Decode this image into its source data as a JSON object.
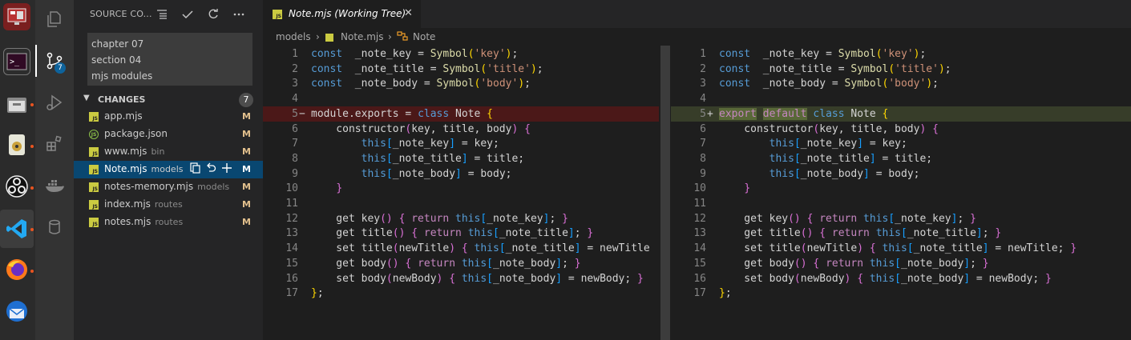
{
  "sidebar": {
    "title": "SOURCE CO...",
    "commit_message": [
      "chapter 07",
      "section 04",
      "mjs modules"
    ],
    "changes_label": "CHANGES",
    "changes_count": "7",
    "scm_badge": "7",
    "files": [
      {
        "name": "app.mjs",
        "dir": "",
        "status": "M",
        "icon": "js-file-icon"
      },
      {
        "name": "package.json",
        "dir": "",
        "status": "M",
        "icon": "json-file-icon"
      },
      {
        "name": "www.mjs",
        "dir": "bin",
        "status": "M",
        "icon": "js-file-icon"
      },
      {
        "name": "Note.mjs",
        "dir": "models",
        "status": "M",
        "icon": "js-file-icon",
        "selected": true
      },
      {
        "name": "notes-memory.mjs",
        "dir": "models",
        "status": "M",
        "icon": "js-file-icon"
      },
      {
        "name": "index.mjs",
        "dir": "routes",
        "status": "M",
        "icon": "js-file-icon"
      },
      {
        "name": "notes.mjs",
        "dir": "routes",
        "status": "M",
        "icon": "js-file-icon"
      }
    ]
  },
  "tab": {
    "label": "Note.mjs (Working Tree)",
    "close": "✕"
  },
  "breadcrumb": {
    "items": [
      "models",
      "Note.mjs",
      "Note"
    ]
  },
  "diff": {
    "left": [
      {
        "n": "1",
        "marker": "",
        "tokens": [
          [
            "kw",
            "const"
          ],
          [
            "",
            "  _note_key "
          ],
          [
            "",
            "= "
          ],
          [
            "fn",
            "Symbol"
          ],
          [
            "br1",
            "("
          ],
          [
            "str",
            "'key'"
          ],
          [
            "br1",
            ")"
          ],
          [
            "",
            ";"
          ]
        ]
      },
      {
        "n": "2",
        "marker": "",
        "tokens": [
          [
            "kw",
            "const"
          ],
          [
            "",
            "  _note_title "
          ],
          [
            "",
            "= "
          ],
          [
            "fn",
            "Symbol"
          ],
          [
            "br1",
            "("
          ],
          [
            "str",
            "'title'"
          ],
          [
            "br1",
            ")"
          ],
          [
            "",
            ";"
          ]
        ]
      },
      {
        "n": "3",
        "marker": "",
        "tokens": [
          [
            "kw",
            "const"
          ],
          [
            "",
            "  _note_body "
          ],
          [
            "",
            "= "
          ],
          [
            "fn",
            "Symbol"
          ],
          [
            "br1",
            "("
          ],
          [
            "str",
            "'body'"
          ],
          [
            "br1",
            ")"
          ],
          [
            "",
            ";"
          ]
        ]
      },
      {
        "n": "4",
        "marker": "",
        "tokens": []
      },
      {
        "n": "5",
        "marker": "−",
        "type": "removed",
        "tokens": [
          [
            "",
            "module.exports = "
          ],
          [
            "kw",
            "class"
          ],
          [
            "",
            " Note "
          ],
          [
            "br1",
            "{"
          ]
        ]
      },
      {
        "n": "6",
        "marker": "",
        "tokens": [
          [
            "",
            "    constructor"
          ],
          [
            "br2",
            "("
          ],
          [
            "",
            "key, title, body"
          ],
          [
            "br2",
            ")"
          ],
          [
            "",
            " "
          ],
          [
            "br2",
            "{"
          ]
        ]
      },
      {
        "n": "7",
        "marker": "",
        "tokens": [
          [
            "",
            "        "
          ],
          [
            "kw",
            "this"
          ],
          [
            "br3",
            "["
          ],
          [
            "",
            "_note_key"
          ],
          [
            "br3",
            "]"
          ],
          [
            "",
            " = key;"
          ]
        ]
      },
      {
        "n": "8",
        "marker": "",
        "tokens": [
          [
            "",
            "        "
          ],
          [
            "kw",
            "this"
          ],
          [
            "br3",
            "["
          ],
          [
            "",
            "_note_title"
          ],
          [
            "br3",
            "]"
          ],
          [
            "",
            " = title;"
          ]
        ]
      },
      {
        "n": "9",
        "marker": "",
        "tokens": [
          [
            "",
            "        "
          ],
          [
            "kw",
            "this"
          ],
          [
            "br3",
            "["
          ],
          [
            "",
            "_note_body"
          ],
          [
            "br3",
            "]"
          ],
          [
            "",
            " = body;"
          ]
        ]
      },
      {
        "n": "10",
        "marker": "",
        "tokens": [
          [
            "",
            "    "
          ],
          [
            "br2",
            "}"
          ]
        ]
      },
      {
        "n": "11",
        "marker": "",
        "tokens": []
      },
      {
        "n": "12",
        "marker": "",
        "tokens": [
          [
            "",
            "    get key"
          ],
          [
            "br2",
            "()"
          ],
          [
            "",
            " "
          ],
          [
            "br2",
            "{"
          ],
          [
            "",
            " "
          ],
          [
            "ctl",
            "return"
          ],
          [
            "",
            " "
          ],
          [
            "kw",
            "this"
          ],
          [
            "br3",
            "["
          ],
          [
            "",
            "_note_key"
          ],
          [
            "br3",
            "]"
          ],
          [
            "",
            "; "
          ],
          [
            "br2",
            "}"
          ]
        ]
      },
      {
        "n": "13",
        "marker": "",
        "tokens": [
          [
            "",
            "    get title"
          ],
          [
            "br2",
            "()"
          ],
          [
            "",
            " "
          ],
          [
            "br2",
            "{"
          ],
          [
            "",
            " "
          ],
          [
            "ctl",
            "return"
          ],
          [
            "",
            " "
          ],
          [
            "kw",
            "this"
          ],
          [
            "br3",
            "["
          ],
          [
            "",
            "_note_title"
          ],
          [
            "br3",
            "]"
          ],
          [
            "",
            "; "
          ],
          [
            "br2",
            "}"
          ]
        ]
      },
      {
        "n": "14",
        "marker": "",
        "tokens": [
          [
            "",
            "    set title"
          ],
          [
            "br2",
            "("
          ],
          [
            "",
            "newTitle"
          ],
          [
            "br2",
            ")"
          ],
          [
            "",
            " "
          ],
          [
            "br2",
            "{"
          ],
          [
            "",
            " "
          ],
          [
            "kw",
            "this"
          ],
          [
            "br3",
            "["
          ],
          [
            "",
            "_note_title"
          ],
          [
            "br3",
            "]"
          ],
          [
            "",
            " = newTitle"
          ]
        ]
      },
      {
        "n": "15",
        "marker": "",
        "tokens": [
          [
            "",
            "    get body"
          ],
          [
            "br2",
            "()"
          ],
          [
            "",
            " "
          ],
          [
            "br2",
            "{"
          ],
          [
            "",
            " "
          ],
          [
            "ctl",
            "return"
          ],
          [
            "",
            " "
          ],
          [
            "kw",
            "this"
          ],
          [
            "br3",
            "["
          ],
          [
            "",
            "_note_body"
          ],
          [
            "br3",
            "]"
          ],
          [
            "",
            "; "
          ],
          [
            "br2",
            "}"
          ]
        ]
      },
      {
        "n": "16",
        "marker": "",
        "tokens": [
          [
            "",
            "    set body"
          ],
          [
            "br2",
            "("
          ],
          [
            "",
            "newBody"
          ],
          [
            "br2",
            ")"
          ],
          [
            "",
            " "
          ],
          [
            "br2",
            "{"
          ],
          [
            "",
            " "
          ],
          [
            "kw",
            "this"
          ],
          [
            "br3",
            "["
          ],
          [
            "",
            "_note_body"
          ],
          [
            "br3",
            "]"
          ],
          [
            "",
            " = newBody; "
          ],
          [
            "br2",
            "}"
          ]
        ]
      },
      {
        "n": "17",
        "marker": "",
        "tokens": [
          [
            "br1",
            "}"
          ],
          [
            "",
            ";"
          ]
        ]
      }
    ],
    "right": [
      {
        "n": "1",
        "marker": "",
        "tokens": [
          [
            "kw",
            "const"
          ],
          [
            "",
            "  _note_key "
          ],
          [
            "",
            "= "
          ],
          [
            "fn",
            "Symbol"
          ],
          [
            "br1",
            "("
          ],
          [
            "str",
            "'key'"
          ],
          [
            "br1",
            ")"
          ],
          [
            "",
            ";"
          ]
        ]
      },
      {
        "n": "2",
        "marker": "",
        "tokens": [
          [
            "kw",
            "const"
          ],
          [
            "",
            "  _note_title "
          ],
          [
            "",
            "= "
          ],
          [
            "fn",
            "Symbol"
          ],
          [
            "br1",
            "("
          ],
          [
            "str",
            "'title'"
          ],
          [
            "br1",
            ")"
          ],
          [
            "",
            ";"
          ]
        ]
      },
      {
        "n": "3",
        "marker": "",
        "tokens": [
          [
            "kw",
            "const"
          ],
          [
            "",
            "  _note_body "
          ],
          [
            "",
            "= "
          ],
          [
            "fn",
            "Symbol"
          ],
          [
            "br1",
            "("
          ],
          [
            "str",
            "'body'"
          ],
          [
            "br1",
            ")"
          ],
          [
            "",
            ";"
          ]
        ]
      },
      {
        "n": "4",
        "marker": "",
        "tokens": []
      },
      {
        "n": "5",
        "marker": "+",
        "type": "added",
        "tokens": [
          [
            "ctl hl-add",
            "export"
          ],
          [
            "",
            " "
          ],
          [
            "ctl hl-add",
            "default"
          ],
          [
            "",
            " "
          ],
          [
            "kw",
            "class"
          ],
          [
            "",
            " Note "
          ],
          [
            "br1",
            "{"
          ]
        ]
      },
      {
        "n": "6",
        "marker": "",
        "tokens": [
          [
            "",
            "    constructor"
          ],
          [
            "br2",
            "("
          ],
          [
            "",
            "key, title, body"
          ],
          [
            "br2",
            ")"
          ],
          [
            "",
            " "
          ],
          [
            "br2",
            "{"
          ]
        ]
      },
      {
        "n": "7",
        "marker": "",
        "tokens": [
          [
            "",
            "        "
          ],
          [
            "kw",
            "this"
          ],
          [
            "br3",
            "["
          ],
          [
            "",
            "_note_key"
          ],
          [
            "br3",
            "]"
          ],
          [
            "",
            " = key;"
          ]
        ]
      },
      {
        "n": "8",
        "marker": "",
        "tokens": [
          [
            "",
            "        "
          ],
          [
            "kw",
            "this"
          ],
          [
            "br3",
            "["
          ],
          [
            "",
            "_note_title"
          ],
          [
            "br3",
            "]"
          ],
          [
            "",
            " = title;"
          ]
        ]
      },
      {
        "n": "9",
        "marker": "",
        "tokens": [
          [
            "",
            "        "
          ],
          [
            "kw",
            "this"
          ],
          [
            "br3",
            "["
          ],
          [
            "",
            "_note_body"
          ],
          [
            "br3",
            "]"
          ],
          [
            "",
            " = body;"
          ]
        ]
      },
      {
        "n": "10",
        "marker": "",
        "tokens": [
          [
            "",
            "    "
          ],
          [
            "br2",
            "}"
          ]
        ]
      },
      {
        "n": "11",
        "marker": "",
        "tokens": []
      },
      {
        "n": "12",
        "marker": "",
        "tokens": [
          [
            "",
            "    get key"
          ],
          [
            "br2",
            "()"
          ],
          [
            "",
            " "
          ],
          [
            "br2",
            "{"
          ],
          [
            "",
            " "
          ],
          [
            "ctl",
            "return"
          ],
          [
            "",
            " "
          ],
          [
            "kw",
            "this"
          ],
          [
            "br3",
            "["
          ],
          [
            "",
            "_note_key"
          ],
          [
            "br3",
            "]"
          ],
          [
            "",
            "; "
          ],
          [
            "br2",
            "}"
          ]
        ]
      },
      {
        "n": "13",
        "marker": "",
        "tokens": [
          [
            "",
            "    get title"
          ],
          [
            "br2",
            "()"
          ],
          [
            "",
            " "
          ],
          [
            "br2",
            "{"
          ],
          [
            "",
            " "
          ],
          [
            "ctl",
            "return"
          ],
          [
            "",
            " "
          ],
          [
            "kw",
            "this"
          ],
          [
            "br3",
            "["
          ],
          [
            "",
            "_note_title"
          ],
          [
            "br3",
            "]"
          ],
          [
            "",
            "; "
          ],
          [
            "br2",
            "}"
          ]
        ]
      },
      {
        "n": "14",
        "marker": "",
        "tokens": [
          [
            "",
            "    set title"
          ],
          [
            "br2",
            "("
          ],
          [
            "",
            "newTitle"
          ],
          [
            "br2",
            ")"
          ],
          [
            "",
            " "
          ],
          [
            "br2",
            "{"
          ],
          [
            "",
            " "
          ],
          [
            "kw",
            "this"
          ],
          [
            "br3",
            "["
          ],
          [
            "",
            "_note_title"
          ],
          [
            "br3",
            "]"
          ],
          [
            "",
            " = newTitle; "
          ],
          [
            "br2",
            "}"
          ]
        ]
      },
      {
        "n": "15",
        "marker": "",
        "tokens": [
          [
            "",
            "    get body"
          ],
          [
            "br2",
            "()"
          ],
          [
            "",
            " "
          ],
          [
            "br2",
            "{"
          ],
          [
            "",
            " "
          ],
          [
            "ctl",
            "return"
          ],
          [
            "",
            " "
          ],
          [
            "kw",
            "this"
          ],
          [
            "br3",
            "["
          ],
          [
            "",
            "_note_body"
          ],
          [
            "br3",
            "]"
          ],
          [
            "",
            "; "
          ],
          [
            "br2",
            "}"
          ]
        ]
      },
      {
        "n": "16",
        "marker": "",
        "tokens": [
          [
            "",
            "    set body"
          ],
          [
            "br2",
            "("
          ],
          [
            "",
            "newBody"
          ],
          [
            "br2",
            ")"
          ],
          [
            "",
            " "
          ],
          [
            "br2",
            "{"
          ],
          [
            "",
            " "
          ],
          [
            "kw",
            "this"
          ],
          [
            "br3",
            "["
          ],
          [
            "",
            "_note_body"
          ],
          [
            "br3",
            "]"
          ],
          [
            "",
            " = newBody; "
          ],
          [
            "br2",
            "}"
          ]
        ]
      },
      {
        "n": "17",
        "marker": "",
        "tokens": [
          [
            "br1",
            "}"
          ],
          [
            "",
            ";"
          ]
        ]
      }
    ]
  },
  "colors": {
    "removed_bg": "#4b1818",
    "added_bg": "#373d29",
    "selection": "#094771",
    "modified": "#e2c08d"
  }
}
